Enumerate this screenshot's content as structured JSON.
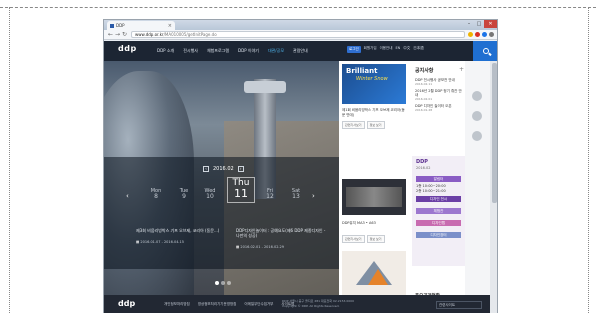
{
  "browser": {
    "tab_title": "DDP",
    "url_host": "www.ddp.or.kr",
    "url_path": "/MA010005/getInitPage.do",
    "min": "–",
    "max": "□",
    "close": "✕"
  },
  "header": {
    "logo": "ddp",
    "gnb": [
      "DDP 소개",
      "전시행사",
      "체험프로그램",
      "DDP 이야기",
      "대관/공모",
      "관람안내"
    ],
    "util": [
      "로그인",
      "회원가입",
      "이용안내",
      "EN",
      "中文",
      "日本語"
    ]
  },
  "hero": {
    "year_month": "2016.02",
    "days": [
      {
        "name": "Mon",
        "num": "8"
      },
      {
        "name": "Tue",
        "num": "9"
      },
      {
        "name": "Wed",
        "num": "10"
      },
      {
        "name": "Thu",
        "num": "11"
      },
      {
        "name": "Fri",
        "num": "12"
      },
      {
        "name": "Sat",
        "num": "13"
      }
    ],
    "events": [
      {
        "title": "제3회 비움리빙박스 기프 오브제, 코리아 (동문...)",
        "date": "2016.01.07 - 2016.04.15"
      },
      {
        "title": "DDP디자인놀이터 : 공예요도(제6 DDP 제종디자인 - 나만의 성공)",
        "date": "2016.02.01 - 2016.02.29"
      }
    ]
  },
  "mid": {
    "banner_line1": "Brilliant",
    "banner_line2": "Winter Snow",
    "card1_caption": "제1회 비움리빙박스 기프 오브제 코리아(동문 만데)",
    "btn_detail": "관련기사보기",
    "btn_more": "정보 보기",
    "card2_caption": "DDP유지 MA3 • A63",
    "card3_caption": "제2기 정비디자인(아이비디) 개인동의계약 협의 우유..."
  },
  "right": {
    "notice_title": "공지사항",
    "notice_more": "+",
    "notices": [
      {
        "title": "DDP 전시행사 공모전 안내",
        "date": "2016.02.11"
      },
      {
        "title": "2016년 2월 DDP 정기 휴관 안내",
        "date": "2016.02.01"
      },
      {
        "title": "DDP 디자인 놀이터 오픈",
        "date": "2016.01.28"
      }
    ],
    "schedule_title": "DDP",
    "schedule_sub": "2016.02",
    "schedule_bars": [
      "알림터",
      "디자인 전시",
      "체험관",
      "디자인랩",
      "디자인장터"
    ],
    "schedule_rows": [
      "1층 10:00~20:00",
      "2층 10:00~21:00"
    ],
    "space_title": "주요공간현황",
    "space_thumb": "알림터",
    "space_desc": "알림 1관 개관일 예정 알림 2관 행사"
  },
  "footer": {
    "logo": "ddp",
    "links": [
      "개인정보처리방침",
      "영상정보처리기기운영방침",
      "이메일무단수집거부",
      "사이트맵"
    ],
    "address": "DDP 서울시 중구 을지로 281 대표전화 02.2153.0000",
    "copyright": "Copyright © DDP. All Rights Reserved.",
    "family_site": "관련사이트"
  },
  "colors": {
    "header_bg": "#1c2533",
    "accent": "#1f6fd1",
    "active_menu": "#4fb6ef",
    "schedule_accent": "#5b2e8f"
  }
}
